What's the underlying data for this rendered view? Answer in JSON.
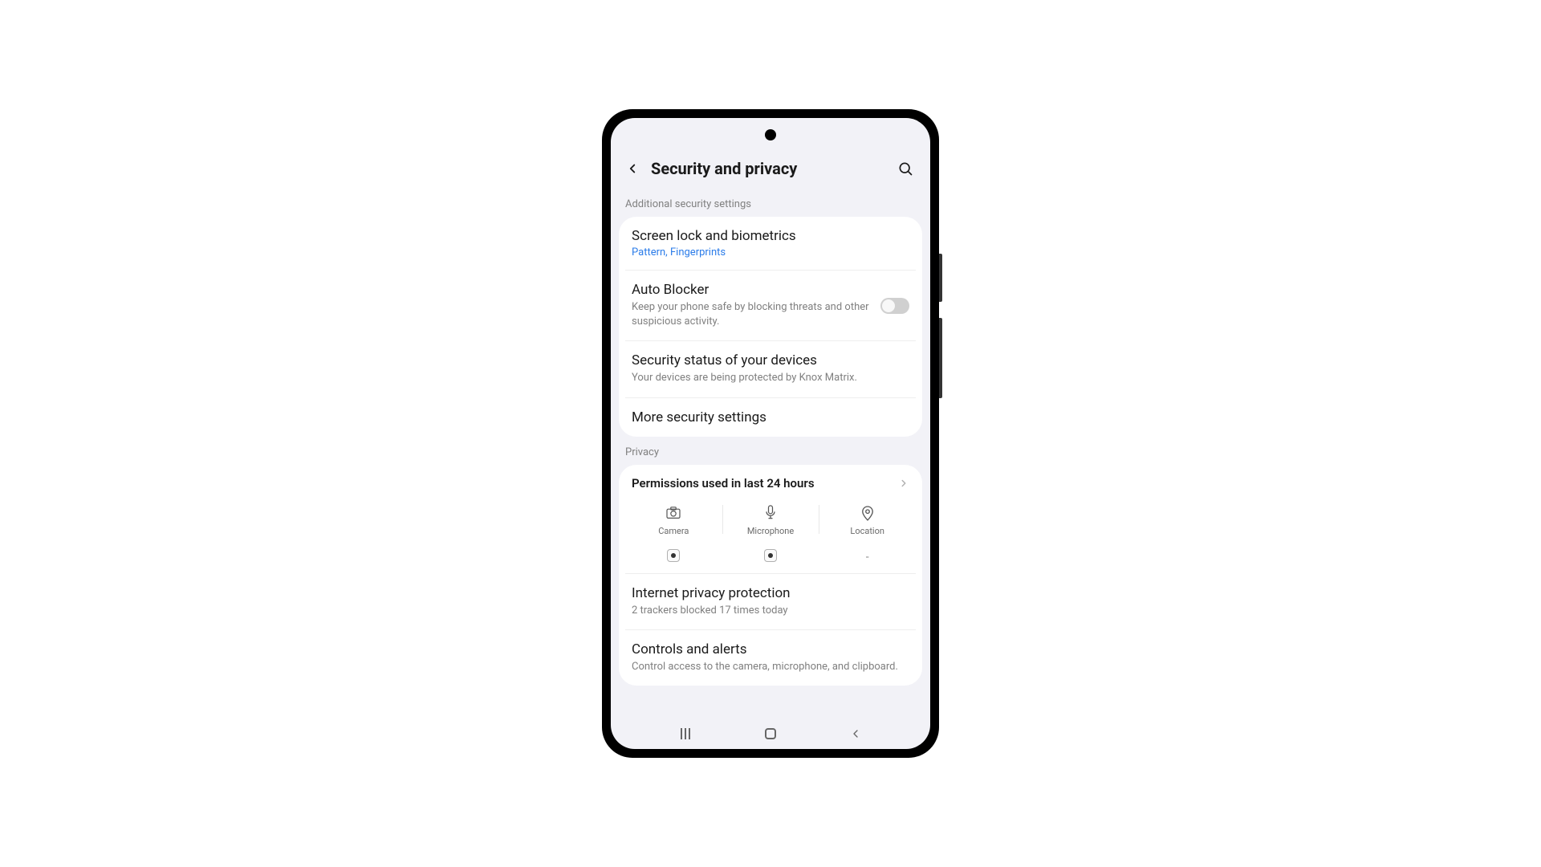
{
  "header": {
    "title": "Security and privacy"
  },
  "sections": {
    "additional": {
      "label": "Additional security settings",
      "screen_lock": {
        "title": "Screen lock and biometrics",
        "subtitle": "Pattern, Fingerprints"
      },
      "auto_blocker": {
        "title": "Auto Blocker",
        "subtitle": "Keep your phone safe by blocking threats and other suspicious activity.",
        "enabled": false
      },
      "security_status": {
        "title": "Security status of your devices",
        "subtitle": "Your devices are being protected by Knox Matrix."
      },
      "more": {
        "title": "More security settings"
      }
    },
    "privacy": {
      "label": "Privacy",
      "permissions": {
        "title": "Permissions used in last 24 hours",
        "columns": {
          "camera": "Camera",
          "microphone": "Microphone",
          "location": "Location"
        },
        "location_value": "-"
      },
      "internet_privacy": {
        "title": "Internet privacy protection",
        "subtitle": "2 trackers blocked 17 times today"
      },
      "controls": {
        "title": "Controls and alerts",
        "subtitle": "Control access to the camera, microphone, and clipboard."
      }
    }
  }
}
